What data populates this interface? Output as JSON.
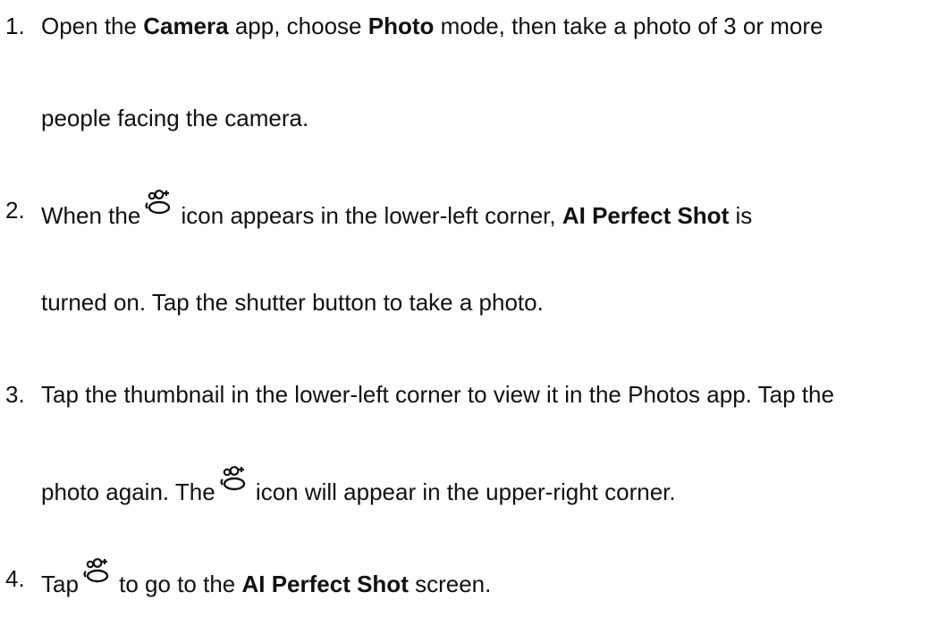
{
  "steps": [
    {
      "number": "1.",
      "line1": {
        "a": "Open the ",
        "b": "Camera",
        "c": " app, choose ",
        "d": "Photo",
        "e": " mode, then take a photo of 3 or more"
      },
      "line2": "people facing the camera."
    },
    {
      "number": "2.",
      "line1": {
        "a": "When the",
        "icon": "ai-perfect-shot-icon",
        "b": " icon appears in the lower-left corner, ",
        "c": "AI Perfect Shot",
        "d": " is"
      },
      "line2": "turned on. Tap the shutter button to take a photo."
    },
    {
      "number": "3.",
      "line1": "Tap the thumbnail in the lower-left corner to view it in the Photos app. Tap the",
      "line2": {
        "a": "photo again. The",
        "icon": "ai-perfect-shot-icon",
        "b": " icon will appear in the upper-right corner."
      }
    },
    {
      "number": "4.",
      "line1": {
        "a": "Tap",
        "icon": "ai-perfect-shot-icon",
        "b": " to go to the ",
        "c": "AI Perfect Shot",
        "d": " screen."
      }
    }
  ]
}
